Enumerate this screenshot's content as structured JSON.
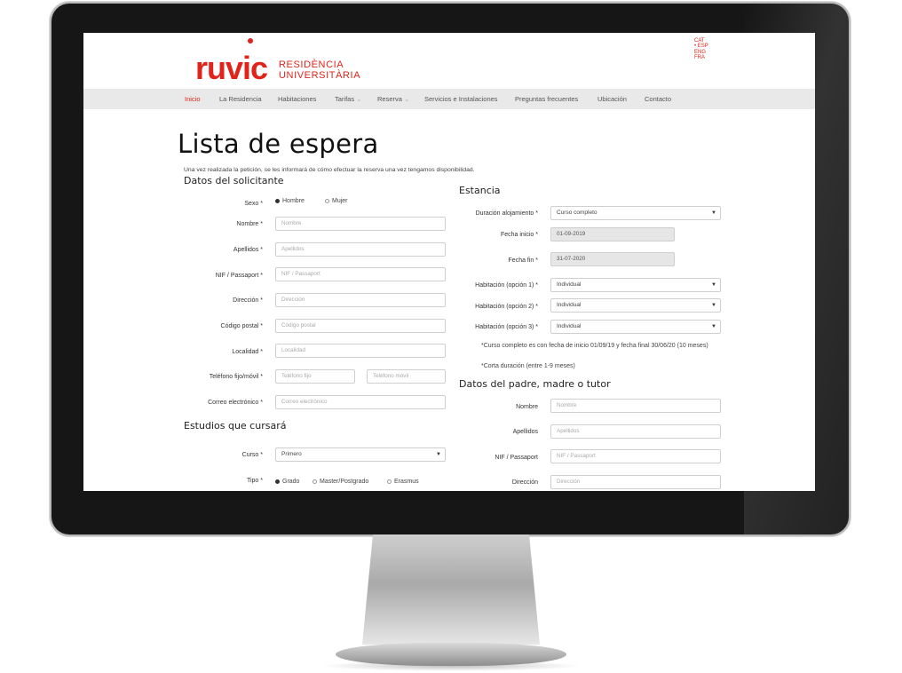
{
  "brand": {
    "logo": "ruvic",
    "line1": "RESIDÈNCIA",
    "line2": "UNIVERSITÀRIA"
  },
  "languages": [
    "CAT",
    "• ESP",
    "ENG",
    "FRA"
  ],
  "nav": [
    "Inicio",
    "La Residencia",
    "Habitaciones",
    "Tarifas",
    "Reserva",
    "Servicios e Instalaciones",
    "Preguntas frecuentes",
    "Ubicación",
    "Contacto"
  ],
  "page": {
    "title": "Lista de espera",
    "intro": "Una vez realizada la petición, se les informará de cómo efectuar la reserva una vez tengamos disponibilidad."
  },
  "solicitante": {
    "heading": "Datos del solicitante",
    "sexo_label": "Sexo *",
    "sexo_options": [
      "Hombre",
      "Mujer"
    ],
    "fields": [
      {
        "label": "Nombre *",
        "placeholder": "Nombre"
      },
      {
        "label": "Apellidos *",
        "placeholder": "Apellidos"
      },
      {
        "label": "NIF / Passaport *",
        "placeholder": "NIF / Passaport"
      },
      {
        "label": "Dirección *",
        "placeholder": "Dirección"
      },
      {
        "label": "Código postal *",
        "placeholder": "Código postal"
      },
      {
        "label": "Localidad *",
        "placeholder": "Localidad"
      }
    ],
    "telefono_label": "Teléfono fijo/móvil *",
    "telefono_fijo": "Teléfono fijo",
    "telefono_movil": "Teléfono móvil",
    "correo_label": "Correo electrónico *",
    "correo_placeholder": "Correo electrónico"
  },
  "estudios": {
    "heading": "Estudios que cursará",
    "curso_label": "Curso *",
    "curso_value": "Primero",
    "tipo_label": "Tipo *",
    "tipo_options": [
      "Grado",
      "Master/Postgrado",
      "Erasmus"
    ]
  },
  "estancia": {
    "heading": "Estancia",
    "duracion_label": "Duración alojamiento *",
    "duracion_value": "Curso completo",
    "fecha_inicio_label": "Fecha inicio *",
    "fecha_inicio_value": "01-09-2019",
    "fecha_fin_label": "Fecha fin *",
    "fecha_fin_value": "31-07-2020",
    "habitaciones": [
      {
        "label": "Habitación (opción 1) *",
        "value": "Individual"
      },
      {
        "label": "Habitación (opción 2) *",
        "value": "Individual"
      },
      {
        "label": "Habitación (opción 3) *",
        "value": "Individual"
      }
    ],
    "note1": "*Curso completo es con fecha de inicio 01/09/19 y fecha final 30/06/20 (10 meses)",
    "note2": "*Corta duración (entre 1-9 meses)"
  },
  "tutor": {
    "heading": "Datos del padre, madre o tutor",
    "fields": [
      {
        "label": "Nombre",
        "placeholder": "Nombre"
      },
      {
        "label": "Apellidos",
        "placeholder": "Apellidos"
      },
      {
        "label": "NIF / Passaport",
        "placeholder": "NIF / Passaport"
      },
      {
        "label": "Dirección",
        "placeholder": "Dirección"
      }
    ]
  },
  "colors": {
    "brand": "#e2231a",
    "nav_bg": "#e9e9e9",
    "bezel": "#161616"
  }
}
